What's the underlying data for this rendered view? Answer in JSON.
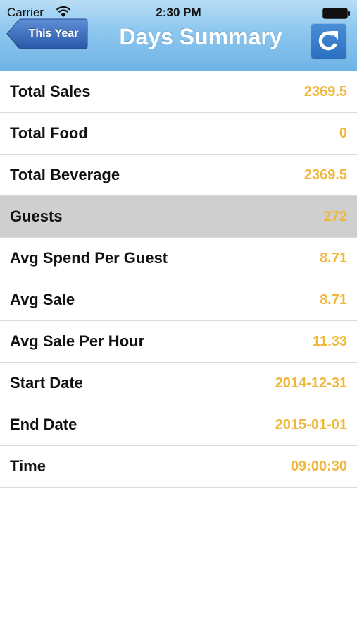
{
  "status_bar": {
    "carrier": "Carrier",
    "time": "2:30 PM",
    "wifi_icon": "wifi-icon",
    "battery_icon": "battery-icon"
  },
  "nav": {
    "back_label": "This Year",
    "title": "Days Summary",
    "refresh_icon": "refresh-icon"
  },
  "colors": {
    "header_blue": "#8fc8ef",
    "back_button_blue": "#2f62b3",
    "refresh_button_blue": "#2a6ec0",
    "value_orange": "#f0b73a",
    "selected_row_gray": "#cfcfcf"
  },
  "rows": [
    {
      "label": "Total Sales",
      "value": "2369.5"
    },
    {
      "label": "Total Food",
      "value": "0"
    },
    {
      "label": "Total Beverage",
      "value": "2369.5"
    },
    {
      "label": "Guests",
      "value": "272",
      "selected": true
    },
    {
      "label": "Avg Spend Per Guest",
      "value": "8.71"
    },
    {
      "label": "Avg Sale",
      "value": "8.71"
    },
    {
      "label": "Avg Sale Per Hour",
      "value": "11.33"
    },
    {
      "label": "Start Date",
      "value": "2014-12-31"
    },
    {
      "label": "End Date",
      "value": "2015-01-01"
    },
    {
      "label": "Time",
      "value": "09:00:30"
    }
  ]
}
